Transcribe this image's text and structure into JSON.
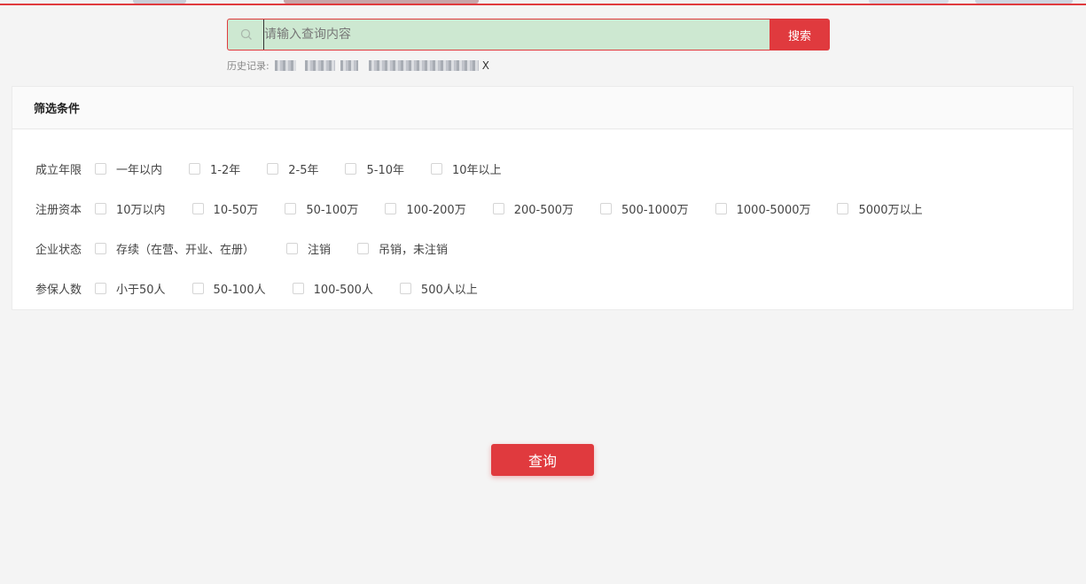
{
  "search": {
    "placeholder": "请输入查询内容",
    "value": "",
    "button_label": "搜索"
  },
  "history": {
    "label": "历史记录:",
    "clear_label": "X"
  },
  "filters": {
    "title": "筛选条件",
    "rows": [
      {
        "label": "成立年限",
        "options": [
          "一年以内",
          "1-2年",
          "2-5年",
          "5-10年",
          "10年以上"
        ]
      },
      {
        "label": "注册资本",
        "options": [
          "10万以内",
          "10-50万",
          "50-100万",
          "100-200万",
          "200-500万",
          "500-1000万",
          "1000-5000万",
          "5000万以上"
        ]
      },
      {
        "label": "企业状态",
        "options": [
          "存续（在营、开业、在册）",
          "注销",
          "吊销，未注销"
        ]
      },
      {
        "label": "参保人数",
        "options": [
          "小于50人",
          "50-100人",
          "100-500人",
          "500人以上"
        ]
      }
    ]
  },
  "query_button_label": "查询",
  "colors": {
    "accent": "#e03a3e",
    "search_bg": "#cde8d1",
    "page_bg": "#f4f4f4"
  }
}
